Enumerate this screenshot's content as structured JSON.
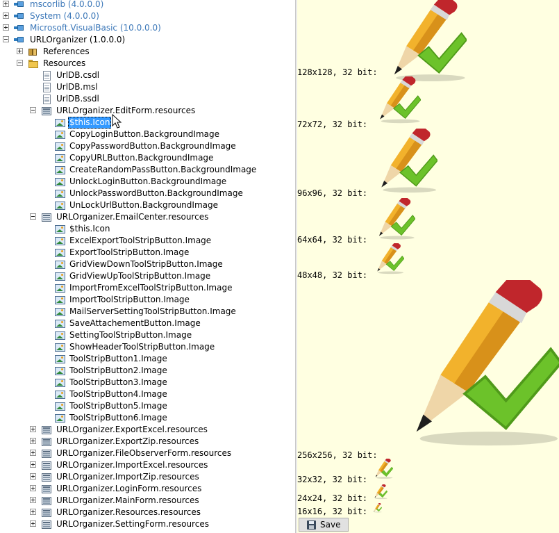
{
  "tree": [
    {
      "label": "mscorlib (4.0.0.0)",
      "depth": 0,
      "expander": "plus",
      "icon": "assembly-icon",
      "style": "blue"
    },
    {
      "label": "System (4.0.0.0)",
      "depth": 0,
      "expander": "plus",
      "icon": "assembly-icon",
      "style": "blue"
    },
    {
      "label": "Microsoft.VisualBasic (10.0.0.0)",
      "depth": 0,
      "expander": "plus",
      "icon": "assembly-icon",
      "style": "blue"
    },
    {
      "label": "URLOrganizer (1.0.0.0)",
      "depth": 0,
      "expander": "minus",
      "icon": "assembly-icon",
      "style": ""
    },
    {
      "label": "References",
      "depth": 1,
      "expander": "plus",
      "icon": "references-icon",
      "style": ""
    },
    {
      "label": "Resources",
      "depth": 1,
      "expander": "minus",
      "icon": "folder-icon",
      "style": ""
    },
    {
      "label": "UrlDB.csdl",
      "depth": 2,
      "expander": "none",
      "icon": "document-icon",
      "style": ""
    },
    {
      "label": "UrlDB.msl",
      "depth": 2,
      "expander": "none",
      "icon": "document-icon",
      "style": ""
    },
    {
      "label": "UrlDB.ssdl",
      "depth": 2,
      "expander": "none",
      "icon": "document-icon",
      "style": ""
    },
    {
      "label": "URLOrganizer.EditForm.resources",
      "depth": 1.5,
      "expander": "minus",
      "icon": "resource-file-icon",
      "style": ""
    },
    {
      "label": "$this.Icon",
      "depth": 3,
      "expander": "none",
      "icon": "image-icon",
      "style": "sel"
    },
    {
      "label": "CopyLoginButton.BackgroundImage",
      "depth": 3,
      "expander": "none",
      "icon": "image-icon",
      "style": ""
    },
    {
      "label": "CopyPasswordButton.BackgroundImage",
      "depth": 3,
      "expander": "none",
      "icon": "image-icon",
      "style": ""
    },
    {
      "label": "CopyURLButton.BackgroundImage",
      "depth": 3,
      "expander": "none",
      "icon": "image-icon",
      "style": ""
    },
    {
      "label": "CreateRandomPassButton.BackgroundImage",
      "depth": 3,
      "expander": "none",
      "icon": "image-icon",
      "style": ""
    },
    {
      "label": "UnlockLoginButton.BackgroundImage",
      "depth": 3,
      "expander": "none",
      "icon": "image-icon",
      "style": ""
    },
    {
      "label": "UnlockPasswordButton.BackgroundImage",
      "depth": 3,
      "expander": "none",
      "icon": "image-icon",
      "style": ""
    },
    {
      "label": "UnLockUrlButton.BackgroundImage",
      "depth": 3,
      "expander": "none",
      "icon": "image-icon",
      "style": ""
    },
    {
      "label": "URLOrganizer.EmailCenter.resources",
      "depth": 1.5,
      "expander": "minus",
      "icon": "resource-file-icon",
      "style": ""
    },
    {
      "label": "$this.Icon",
      "depth": 3,
      "expander": "none",
      "icon": "image-icon",
      "style": ""
    },
    {
      "label": "ExcelExportToolStripButton.Image",
      "depth": 3,
      "expander": "none",
      "icon": "image-icon",
      "style": ""
    },
    {
      "label": "ExportToolStripButton.Image",
      "depth": 3,
      "expander": "none",
      "icon": "image-icon",
      "style": ""
    },
    {
      "label": "GridViewDownToolStripButton.Image",
      "depth": 3,
      "expander": "none",
      "icon": "image-icon",
      "style": ""
    },
    {
      "label": "GridViewUpToolStripButton.Image",
      "depth": 3,
      "expander": "none",
      "icon": "image-icon",
      "style": ""
    },
    {
      "label": "ImportFromExcelToolStripButton.Image",
      "depth": 3,
      "expander": "none",
      "icon": "image-icon",
      "style": ""
    },
    {
      "label": "ImportToolStripButton.Image",
      "depth": 3,
      "expander": "none",
      "icon": "image-icon",
      "style": ""
    },
    {
      "label": "MailServerSettingToolStripButton.Image",
      "depth": 3,
      "expander": "none",
      "icon": "image-icon",
      "style": ""
    },
    {
      "label": "SaveAttachementButton.Image",
      "depth": 3,
      "expander": "none",
      "icon": "image-icon",
      "style": ""
    },
    {
      "label": "SettingToolStripButton.Image",
      "depth": 3,
      "expander": "none",
      "icon": "image-icon",
      "style": ""
    },
    {
      "label": "ShowHeaderToolStripButton.Image",
      "depth": 3,
      "expander": "none",
      "icon": "image-icon",
      "style": ""
    },
    {
      "label": "ToolStripButton1.Image",
      "depth": 3,
      "expander": "none",
      "icon": "image-icon",
      "style": ""
    },
    {
      "label": "ToolStripButton2.Image",
      "depth": 3,
      "expander": "none",
      "icon": "image-icon",
      "style": ""
    },
    {
      "label": "ToolStripButton3.Image",
      "depth": 3,
      "expander": "none",
      "icon": "image-icon",
      "style": ""
    },
    {
      "label": "ToolStripButton4.Image",
      "depth": 3,
      "expander": "none",
      "icon": "image-icon",
      "style": ""
    },
    {
      "label": "ToolStripButton5.Image",
      "depth": 3,
      "expander": "none",
      "icon": "image-icon",
      "style": ""
    },
    {
      "label": "ToolStripButton6.Image",
      "depth": 3,
      "expander": "none",
      "icon": "image-icon",
      "style": ""
    },
    {
      "label": "URLOrganizer.ExportExcel.resources",
      "depth": 1.5,
      "expander": "plus",
      "icon": "resource-file-icon",
      "style": ""
    },
    {
      "label": "URLOrganizer.ExportZip.resources",
      "depth": 1.5,
      "expander": "plus",
      "icon": "resource-file-icon",
      "style": ""
    },
    {
      "label": "URLOrganizer.FileObserverForm.resources",
      "depth": 1.5,
      "expander": "plus",
      "icon": "resource-file-icon",
      "style": ""
    },
    {
      "label": "URLOrganizer.ImportExcel.resources",
      "depth": 1.5,
      "expander": "plus",
      "icon": "resource-file-icon",
      "style": ""
    },
    {
      "label": "URLOrganizer.ImportZip.resources",
      "depth": 1.5,
      "expander": "plus",
      "icon": "resource-file-icon",
      "style": ""
    },
    {
      "label": "URLOrganizer.LoginForm.resources",
      "depth": 1.5,
      "expander": "plus",
      "icon": "resource-file-icon",
      "style": ""
    },
    {
      "label": "URLOrganizer.MainForm.resources",
      "depth": 1.5,
      "expander": "plus",
      "icon": "resource-file-icon",
      "style": ""
    },
    {
      "label": "URLOrganizer.Resources.resources",
      "depth": 1.5,
      "expander": "plus",
      "icon": "resource-file-icon",
      "style": ""
    },
    {
      "label": "URLOrganizer.SettingForm.resources",
      "depth": 1.5,
      "expander": "plus",
      "icon": "resource-file-icon",
      "style": ""
    }
  ],
  "preview": {
    "icon_name": "pencil-checkmark-icon",
    "sizes": [
      {
        "label": "128x128, 32 bit:",
        "size": 128
      },
      {
        "label": "72x72, 32 bit:",
        "size": 72
      },
      {
        "label": "96x96, 32 bit:",
        "size": 96
      },
      {
        "label": "64x64, 32 bit:",
        "size": 64
      },
      {
        "label": "48x48, 32 bit:",
        "size": 48
      },
      {
        "label": "256x256, 32 bit:",
        "size": 256
      },
      {
        "label": "32x32, 32 bit:",
        "size": 32
      },
      {
        "label": "24x24, 32 bit:",
        "size": 24
      },
      {
        "label": "16x16, 32 bit:",
        "size": 16
      }
    ],
    "save_label": "Save"
  },
  "colors": {
    "preview_background": "#ffffe1",
    "selection": "#3399ff",
    "framework_assembly_text": "#3b77b8",
    "pencil_body": "#f2b22c",
    "pencil_eraser": "#c0262c",
    "check_green": "#6cc22a"
  }
}
